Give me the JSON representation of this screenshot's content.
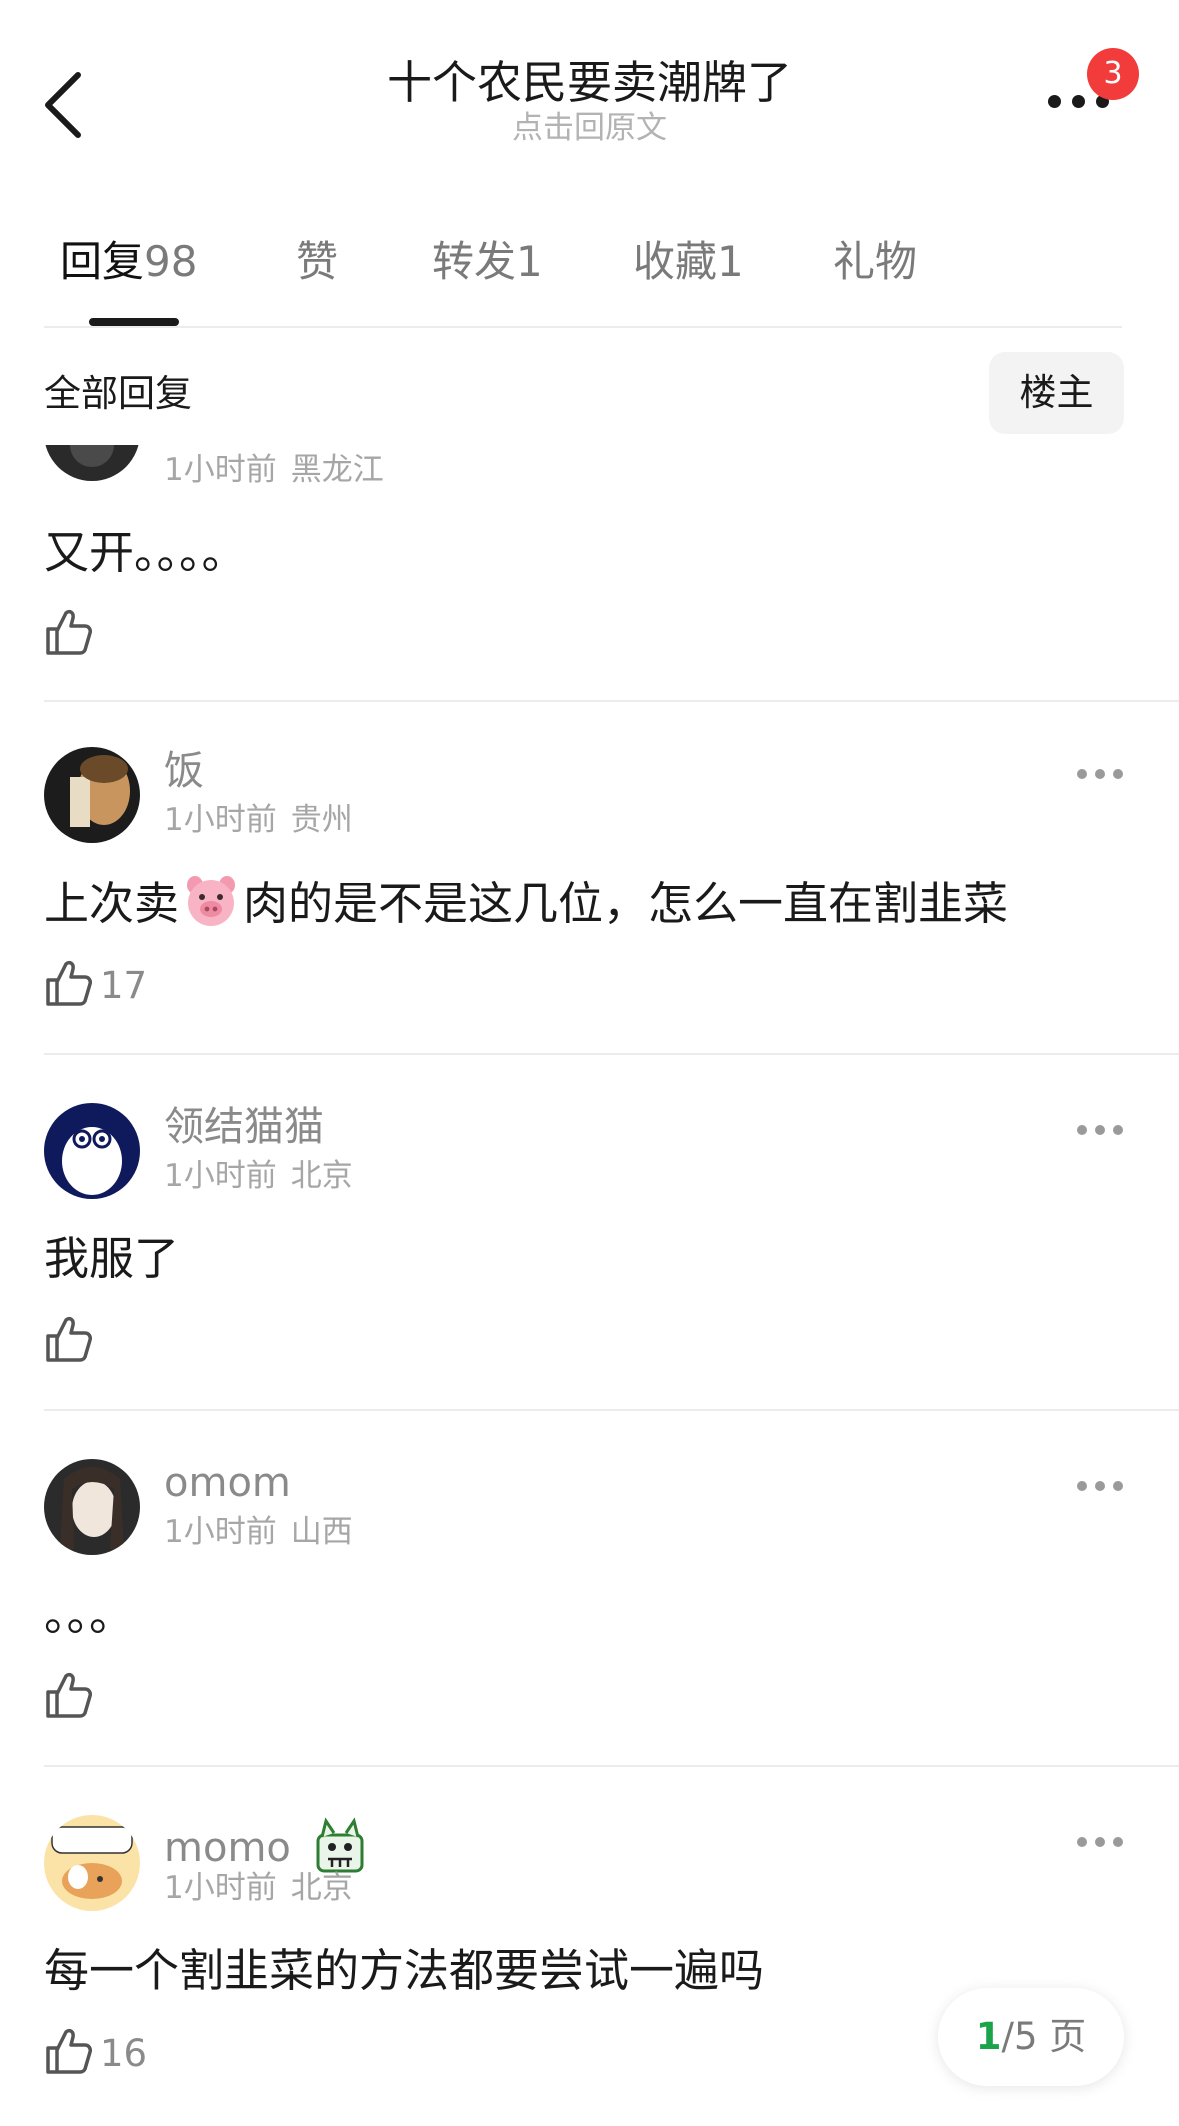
{
  "header": {
    "title": "十个农民要卖潮牌了",
    "subtitle": "点击回原文",
    "notification_count": "3"
  },
  "tabs": [
    {
      "label": "回复",
      "count": "98",
      "active": true
    },
    {
      "label": "赞",
      "count": ""
    },
    {
      "label": "转发",
      "count": "1"
    },
    {
      "label": "收藏",
      "count": "1"
    },
    {
      "label": "礼物",
      "count": ""
    }
  ],
  "filter": {
    "label": "全部回复",
    "owner_button": "楼主"
  },
  "comments": [
    {
      "username": "",
      "time": "1小时前",
      "location": "黑龙江",
      "content": "又开。。。。",
      "likes": ""
    },
    {
      "username": "饭",
      "time": "1小时前",
      "location": "贵州",
      "content_before": "上次卖",
      "emoji": "pig-face-emoji",
      "content_after": "肉的是不是这几位，怎么一直在割韭菜",
      "likes": "17"
    },
    {
      "username": "领结猫猫",
      "time": "1小时前",
      "location": "北京",
      "content": "我服了",
      "likes": ""
    },
    {
      "username": "omom",
      "time": "1小时前",
      "location": "山西",
      "content": "。。。",
      "likes": ""
    },
    {
      "username": "momo",
      "time": "1小时前",
      "location": "北京",
      "content": "每一个割韭菜的方法都要尝试一遍吗",
      "likes": "16",
      "badge_icon": "mascot-badge-icon"
    }
  ],
  "pager": {
    "current": "1",
    "total_text": "/5 页"
  },
  "icons": {
    "back": "chevron-left-icon",
    "more": "more-dots-icon",
    "like": "thumb-up-icon"
  },
  "colors": {
    "badge": "#f23b3b",
    "pager_current": "#1aa34a"
  }
}
